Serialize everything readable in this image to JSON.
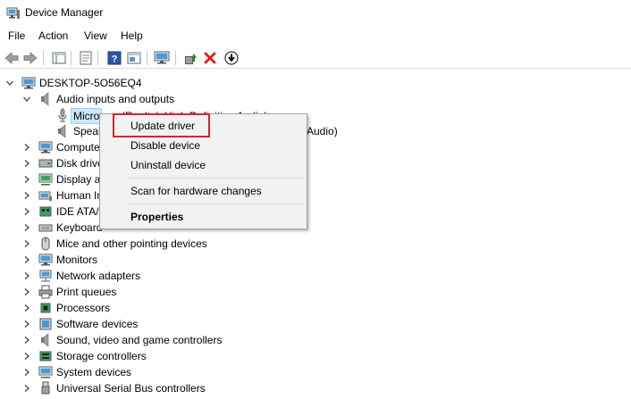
{
  "window": {
    "title": "Device Manager",
    "icon": "device-manager-icon"
  },
  "menu": [
    "File",
    "Action",
    "View",
    "Help"
  ],
  "toolbar": {
    "buttons": [
      "back-icon",
      "forward-icon",
      "show-hide-console-tree-icon",
      "properties-icon",
      "help-icon",
      "action-pane-icon",
      "scan-hardware-icon",
      "update-driver-icon",
      "uninstall-icon",
      "disable-device-icon"
    ],
    "colors": {
      "uninstall": "#d81e1e",
      "update": "#2e8b2e",
      "help": "#2d55a8"
    }
  },
  "tree": {
    "root": "DESKTOP-5O56EQ4",
    "audio_category": "Audio inputs and outputs",
    "audio_children": [
      {
        "label": "Microphone (Realtek High Definition Audio)",
        "visible_prefix": "Micro",
        "visible_tail": "(Realtek High Definition Audio)"
      },
      {
        "label": "Speakers (Realtek High Definition Audio)",
        "visible_prefix": "Speak",
        "visible_tail": "Audio)"
      }
    ],
    "categories": [
      "Compute",
      "Disk drive",
      "Display a",
      "Human In",
      "IDE ATA/A",
      "Keyboard",
      "Mice and other pointing devices",
      "Monitors",
      "Network adapters",
      "Print queues",
      "Processors",
      "Software devices",
      "Sound, video and game controllers",
      "Storage controllers",
      "System devices",
      "Universal Serial Bus controllers"
    ]
  },
  "context_menu": {
    "items": [
      "Update driver",
      "Disable device",
      "Uninstall device",
      "Scan for hardware changes",
      "Properties"
    ],
    "highlight_color": "#d9232a"
  }
}
